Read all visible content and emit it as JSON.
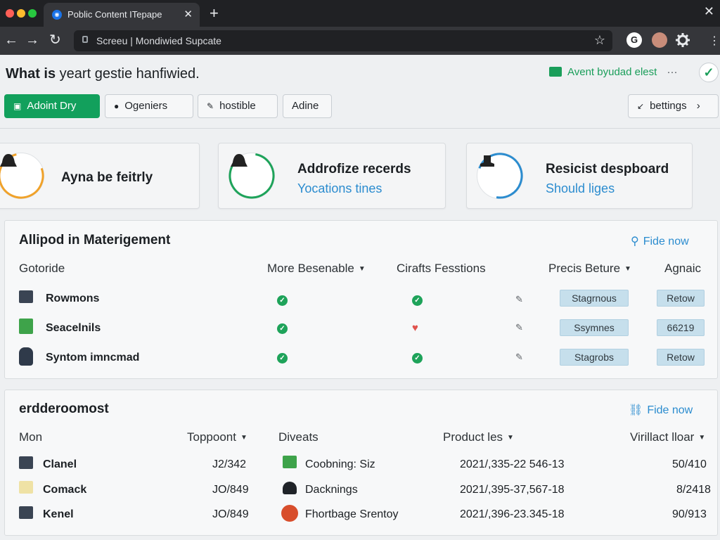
{
  "browser": {
    "tab_title": "Poblic Content ITepape",
    "tab_close": "✕",
    "new_tab": "+",
    "window_close": "✕",
    "url": "Screeu | Mondiwied Supcate",
    "back": "←",
    "forward": "→",
    "reload": "↻",
    "star": "☆",
    "profile_letter": "G",
    "settings_icon": "gear-icon"
  },
  "header": {
    "title_bold": "What is",
    "title_rest": " yeart gestie hanfiwied.",
    "status_text": "Avent byudad elest",
    "status_more": "···",
    "check": "✓"
  },
  "actions": [
    {
      "label": "Adoint Dry",
      "icon": "▣"
    },
    {
      "label": "Ogeniers",
      "icon": "●"
    },
    {
      "label": "hostible",
      "icon": "✎"
    },
    {
      "label": "Adine",
      "icon": ""
    }
  ],
  "settings_button": {
    "label": "bettings",
    "icon": "↙",
    "chevron": "›"
  },
  "cards": [
    {
      "title": "Ayna be feitrly",
      "sub": "",
      "ring_color": "#f0a22a"
    },
    {
      "title": "Addrofize recerds",
      "sub": "Yocations tines",
      "ring_color": "#1ea35a"
    },
    {
      "title": "Resicist despboard",
      "sub": "Should liges",
      "ring_color": "#2b8ccf"
    }
  ],
  "panel1": {
    "title": "Allipod in Materigement",
    "link": "Fide now",
    "columns": [
      "Gotoride",
      "More Besenable",
      "Cirafts Fesstions",
      "Precis Beture",
      "Agnaic"
    ],
    "rows": [
      {
        "name": "Rowmons",
        "c1": "✓",
        "c2": "✓",
        "edit": "✎",
        "pill1": "Stagrnous",
        "pill2": "Retow"
      },
      {
        "name": "Seacelnils",
        "c1": "✓",
        "c2": "♥",
        "edit": "✎",
        "pill1": "Ssymnes",
        "pill2": "66219"
      },
      {
        "name": "Syntom imncmad",
        "c1": "✓",
        "c2": "✓",
        "edit": "✎",
        "pill1": "Stagrobs",
        "pill2": "Retow"
      }
    ]
  },
  "panel2": {
    "title": "erdderoomost",
    "link": "Fide now",
    "columns": [
      "Mon",
      "Toppoont",
      "Diveats",
      "Product les",
      "Virillact lloar"
    ],
    "rows": [
      {
        "name": "Clanel",
        "code": "J2/342",
        "item": "Coobning: Siz",
        "product": "2021/,335-22 546-13",
        "value": "50/410"
      },
      {
        "name": "Comack",
        "code": "JO/849",
        "item": "Dacknings",
        "product": "2021/,395-37,567-18",
        "value": "8/2418"
      },
      {
        "name": "Kenel",
        "code": "JO/849",
        "item": "Fhortbage Srentoy",
        "product": "2021/,396-23.345-18",
        "value": "90/913"
      }
    ]
  },
  "colors": {
    "accent": "#12a05c",
    "link": "#2b8ccf",
    "chrome": "#202124"
  }
}
